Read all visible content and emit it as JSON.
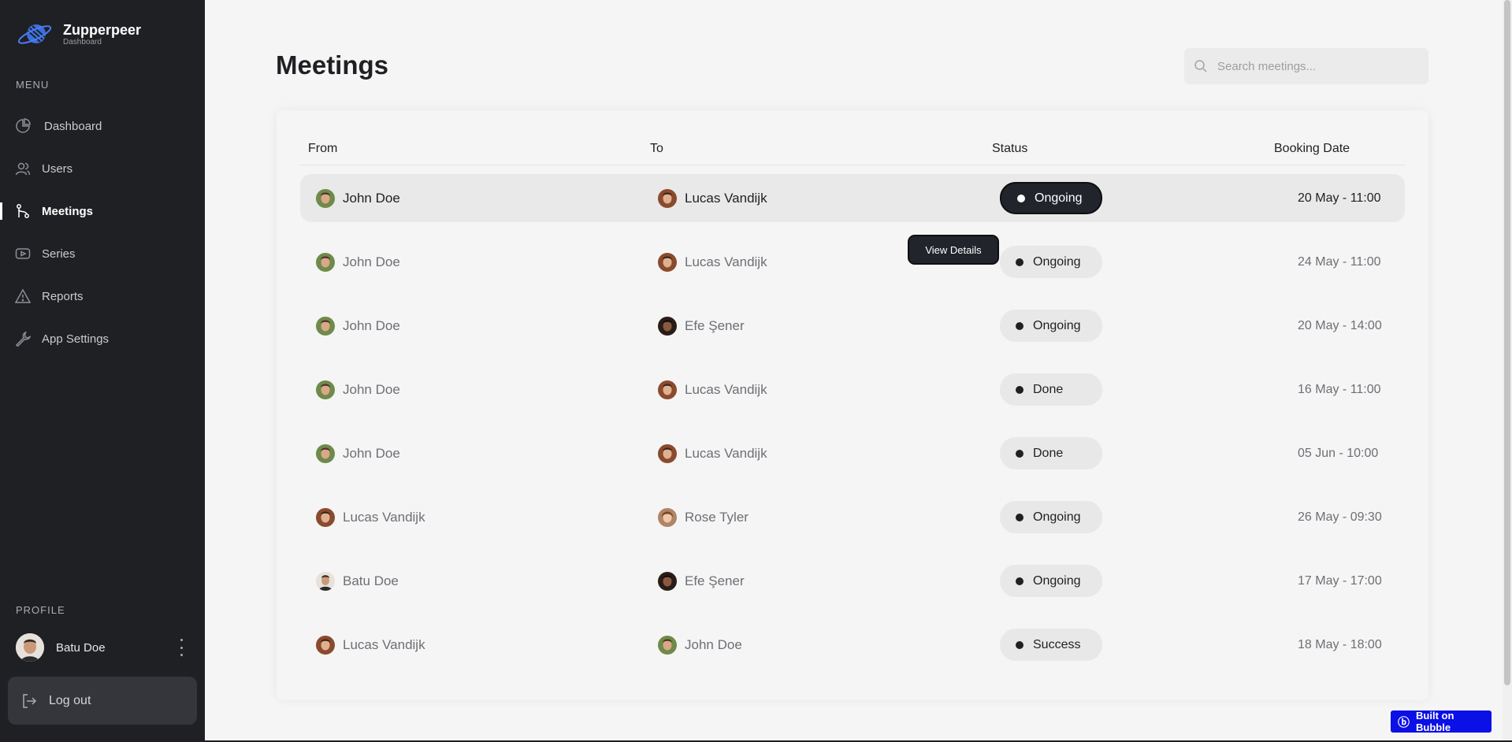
{
  "brand": {
    "name": "Zupperpeer",
    "subtitle": "Dashboard"
  },
  "sidebar": {
    "menu_label": "MENU",
    "items": [
      {
        "label": "Dashboard",
        "icon": "pie-chart-icon",
        "active": false
      },
      {
        "label": "Users",
        "icon": "users-icon",
        "active": false
      },
      {
        "label": "Meetings",
        "icon": "git-branch-icon",
        "active": true
      },
      {
        "label": "Series",
        "icon": "video-icon",
        "active": false
      },
      {
        "label": "Reports",
        "icon": "warning-icon",
        "active": false
      },
      {
        "label": "App Settings",
        "icon": "wrench-icon",
        "active": false
      }
    ],
    "profile_label": "PROFILE",
    "profile_name": "Batu Doe",
    "logout_label": "Log out"
  },
  "page": {
    "title": "Meetings"
  },
  "search": {
    "placeholder": "Search meetings..."
  },
  "table": {
    "columns": [
      "From",
      "To",
      "Status",
      "Booking Date"
    ],
    "rows": [
      {
        "from": "John Doe",
        "to": "Lucas Vandijk",
        "status": "Ongoing",
        "date": "20 May - 11:00"
      },
      {
        "from": "John Doe",
        "to": "Lucas Vandijk",
        "status": "Ongoing",
        "date": "24 May - 11:00"
      },
      {
        "from": "John Doe",
        "to": "Efe Şener",
        "status": "Ongoing",
        "date": "20 May - 14:00"
      },
      {
        "from": "John Doe",
        "to": "Lucas Vandijk",
        "status": "Done",
        "date": "16 May - 11:00"
      },
      {
        "from": "John Doe",
        "to": "Lucas Vandijk",
        "status": "Done",
        "date": "05 Jun - 10:00"
      },
      {
        "from": "Lucas Vandijk",
        "to": "Rose Tyler",
        "status": "Ongoing",
        "date": "26 May - 09:30"
      },
      {
        "from": "Batu Doe",
        "to": "Efe Şener",
        "status": "Ongoing",
        "date": "17 May - 17:00"
      },
      {
        "from": "Lucas Vandijk",
        "to": "John Doe",
        "status": "Success",
        "date": "18 May - 18:00"
      }
    ]
  },
  "tooltip": {
    "label": "View Details"
  },
  "badge": {
    "label": "Built on Bubble"
  },
  "colors": {
    "sidebar_bg": "#1f2024",
    "accent_dark": "#22242b",
    "bubble_blue": "#0b10e6"
  }
}
